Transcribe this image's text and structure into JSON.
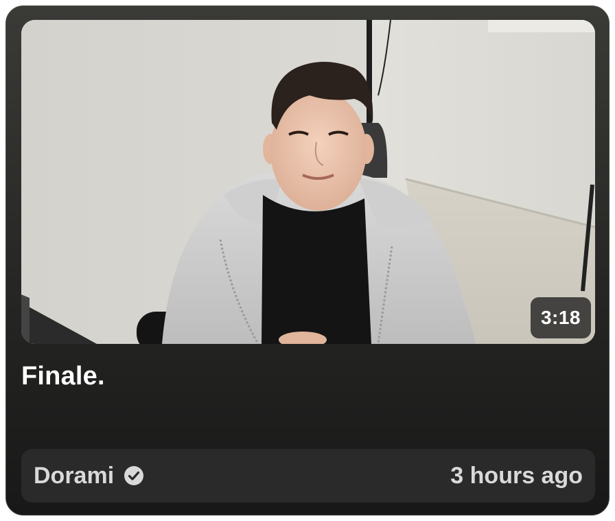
{
  "video": {
    "title": "Finale.",
    "duration": "3:18",
    "channel": "Dorami",
    "verified": true,
    "published": "3 hours ago"
  },
  "icons": {
    "verified": "verified-check-icon"
  },
  "colors": {
    "card_bg": "#262624",
    "meta_bg": "#2a2a2a",
    "text_primary": "#ffffff",
    "text_secondary": "#d9d9d9"
  }
}
